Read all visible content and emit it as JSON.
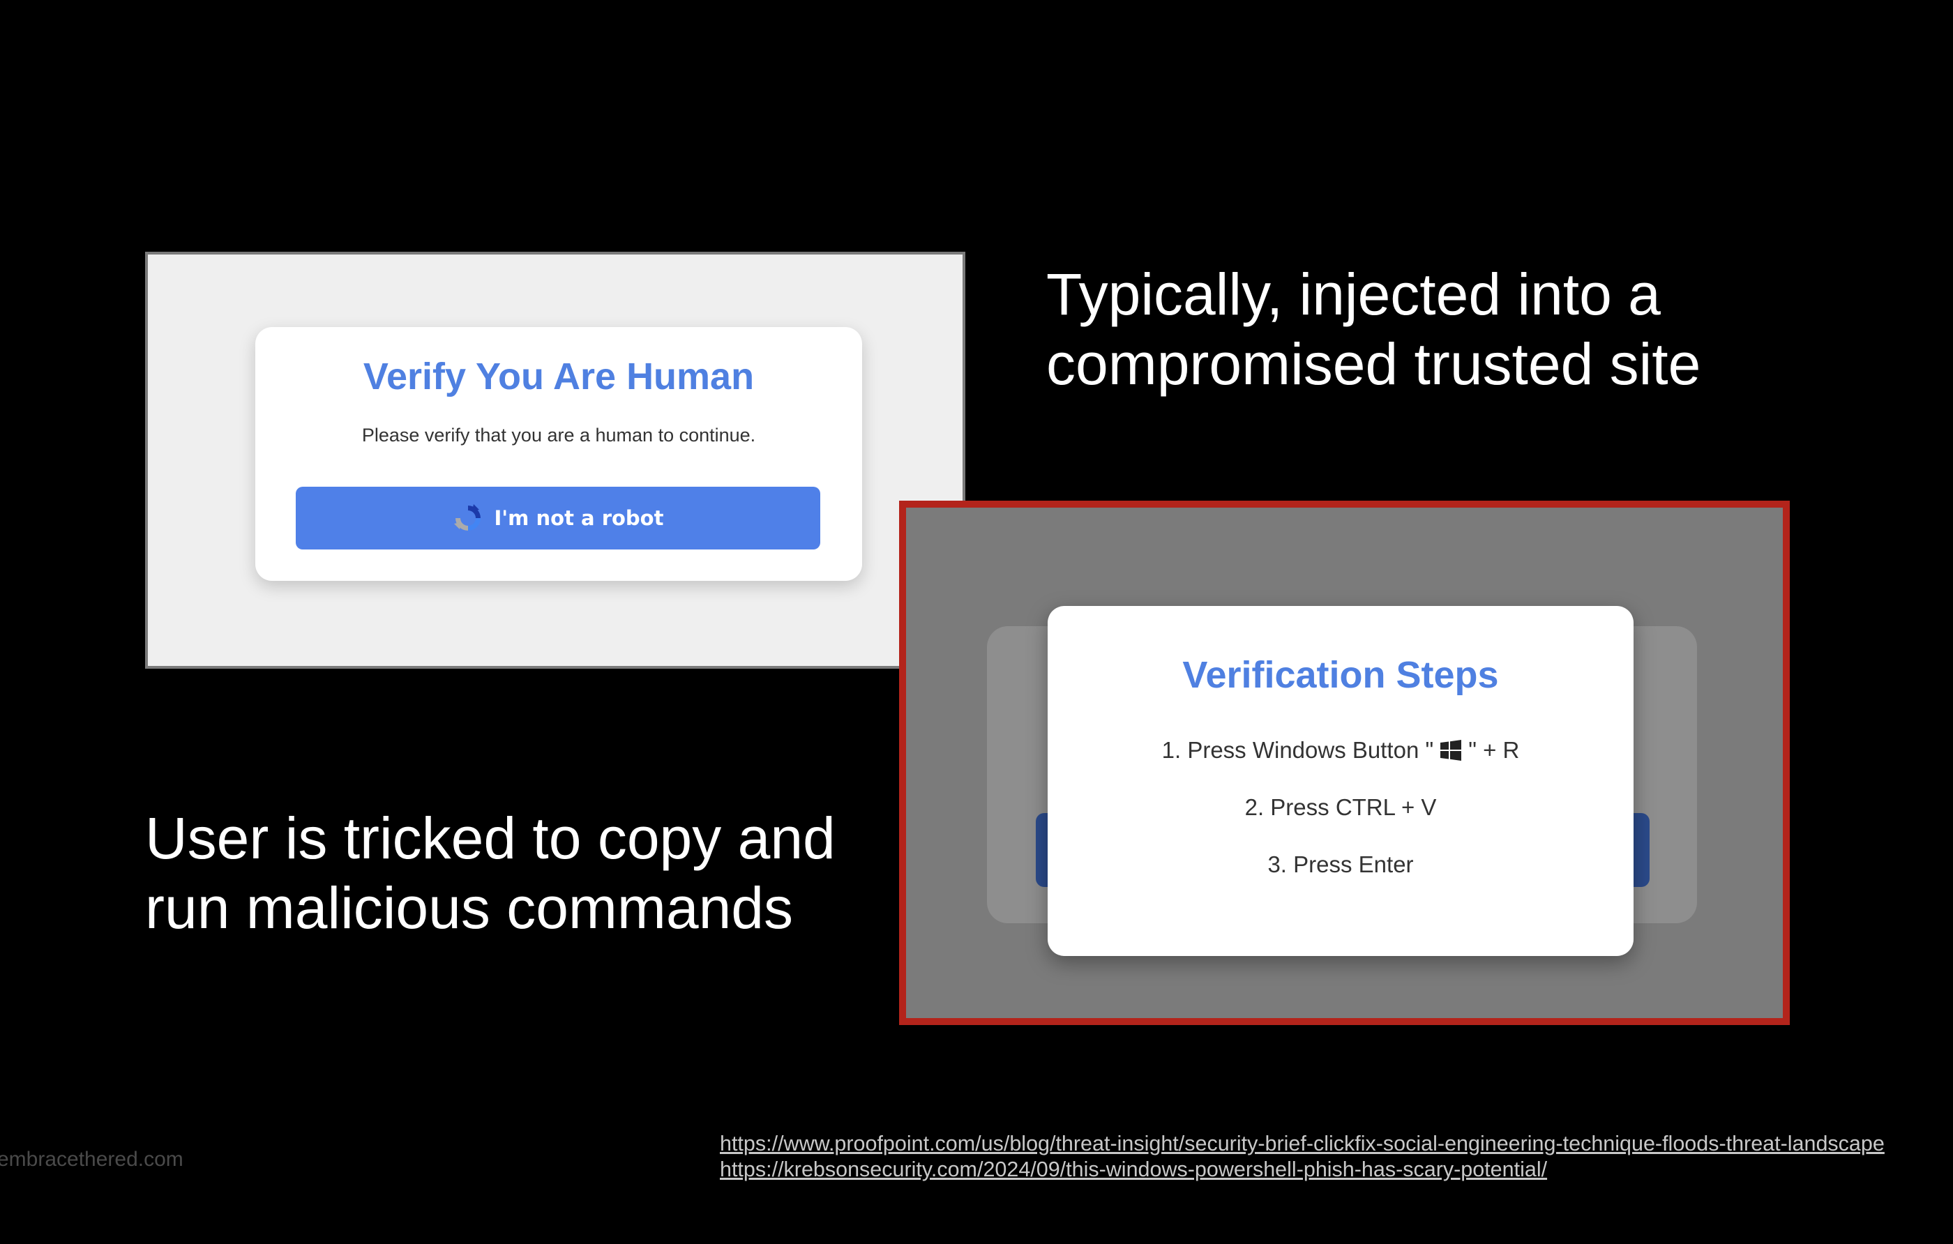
{
  "captcha_page": {
    "title": "Verify You Are Human",
    "subtitle": "Please verify that you are a human to continue.",
    "button_label": "I'm not a robot",
    "button_icon": "recaptcha-icon"
  },
  "slide": {
    "caption_top_line1": "Typically, injected into a",
    "caption_top_line2": "compromised trusted site",
    "caption_bottom_line1": "User is tricked to copy and",
    "caption_bottom_line2": "run malicious commands",
    "watermark": "embracethered.com"
  },
  "verification": {
    "title": "Verification Steps",
    "step1_before_icon": "1. Press Windows Button \"",
    "step1_icon": "windows-logo-icon",
    "step1_after_icon": "\" + R",
    "step2": "2. Press CTRL + V",
    "step3": "3. Press Enter"
  },
  "references": [
    "https://www.proofpoint.com/us/blog/threat-insight/security-brief-clickfix-social-engineering-technique-floods-threat-landscape",
    "https://krebsonsecurity.com/2024/09/this-windows-powershell-phish-has-scary-potential/"
  ],
  "colors": {
    "background": "#000000",
    "accent_blue": "#4f80e1",
    "frame_red": "#b3241b"
  }
}
